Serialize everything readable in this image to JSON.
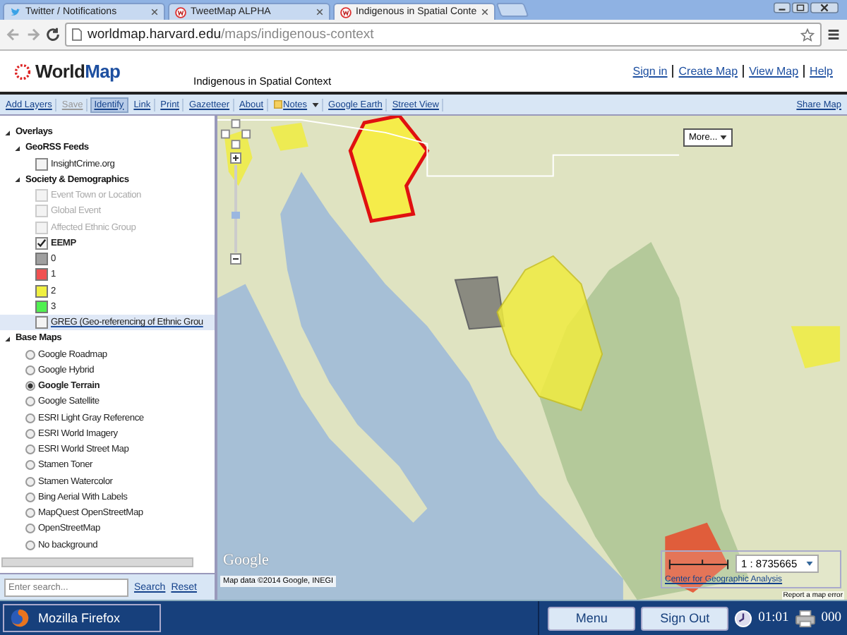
{
  "browser": {
    "tabs": [
      {
        "title": "Twitter / Notifications",
        "selected": false
      },
      {
        "title": "TweetMap ALPHA",
        "selected": false
      },
      {
        "title": "Indigenous in Spatial Conte",
        "selected": true
      }
    ],
    "url": {
      "host": "worldmap.harvard.edu",
      "path": "/maps/indigenous-context"
    }
  },
  "header": {
    "logo_a": "World",
    "logo_b": "Map",
    "title": "Indigenous in Spatial Context",
    "links": [
      "Sign in",
      "Create Map",
      "View Map",
      "Help"
    ]
  },
  "toolbar": {
    "items": [
      {
        "label": "Add Layers",
        "selected": false,
        "disabled": false,
        "kind": "link"
      },
      {
        "label": "Save",
        "selected": false,
        "disabled": true,
        "kind": "link"
      },
      {
        "label": "Identify",
        "selected": true,
        "disabled": false,
        "kind": "link"
      },
      {
        "label": "Link",
        "selected": false,
        "disabled": false,
        "kind": "link"
      },
      {
        "label": "Print",
        "selected": false,
        "disabled": false,
        "kind": "link"
      },
      {
        "label": "Gazetteer",
        "selected": false,
        "disabled": false,
        "kind": "link"
      },
      {
        "label": "About",
        "selected": false,
        "disabled": false,
        "kind": "link"
      },
      {
        "label": "Notes",
        "selected": false,
        "disabled": false,
        "kind": "dropdown"
      },
      {
        "label": "Google Earth",
        "selected": false,
        "disabled": false,
        "kind": "link"
      },
      {
        "label": "Street View",
        "selected": false,
        "disabled": false,
        "kind": "link"
      }
    ],
    "share": "Share Map"
  },
  "sidebar": {
    "tree": [
      {
        "kind": "folder",
        "label": "Overlays",
        "expanded": true,
        "children": [
          {
            "kind": "folder",
            "label": "GeoRSS Feeds",
            "expanded": true,
            "children": [
              {
                "kind": "checkbox",
                "label": "InsightCrime.org",
                "checked": false,
                "disabled": false,
                "selected": false
              }
            ]
          },
          {
            "kind": "folder",
            "label": "Society & Demographics",
            "expanded": true,
            "children": [
              {
                "kind": "checkbox",
                "label": "Event Town or Location",
                "checked": false,
                "disabled": true,
                "selected": false
              },
              {
                "kind": "checkbox",
                "label": "Global Event",
                "checked": false,
                "disabled": true,
                "selected": false
              },
              {
                "kind": "checkbox",
                "label": "Affected Ethnic Group",
                "checked": false,
                "disabled": true,
                "selected": false
              },
              {
                "kind": "checkbox",
                "label": "EEMP",
                "checked": true,
                "disabled": false,
                "selected": false
              },
              {
                "kind": "legend",
                "label": "0",
                "color": "#a0a0a0"
              },
              {
                "kind": "legend",
                "label": "1",
                "color": "#f05050"
              },
              {
                "kind": "legend",
                "label": "2",
                "color": "#f0f040"
              },
              {
                "kind": "legend",
                "label": "3",
                "color": "#50f050"
              },
              {
                "kind": "checkbox",
                "label": "GREG (Geo-referencing of Ethnic Grou",
                "checked": false,
                "disabled": false,
                "selected": true
              }
            ]
          }
        ]
      },
      {
        "kind": "folder",
        "label": "Base Maps",
        "expanded": true,
        "children": [
          {
            "kind": "radio",
            "label": "Google Roadmap",
            "selected": false
          },
          {
            "kind": "radio",
            "label": "Google Hybrid",
            "selected": false
          },
          {
            "kind": "radio",
            "label": "Google Terrain",
            "selected": true
          },
          {
            "kind": "radio",
            "label": "Google Satellite",
            "selected": false
          },
          {
            "kind": "radio",
            "label": "ESRI Light Gray Reference",
            "selected": false
          },
          {
            "kind": "radio",
            "label": "ESRI World Imagery",
            "selected": false
          },
          {
            "kind": "radio",
            "label": "ESRI World Street Map",
            "selected": false
          },
          {
            "kind": "radio",
            "label": "Stamen Toner",
            "selected": false
          },
          {
            "kind": "radio",
            "label": "Stamen Watercolor",
            "selected": false
          },
          {
            "kind": "radio",
            "label": "Bing Aerial With Labels",
            "selected": false
          },
          {
            "kind": "radio",
            "label": "MapQuest OpenStreetMap",
            "selected": false
          },
          {
            "kind": "radio",
            "label": "OpenStreetMap",
            "selected": false
          },
          {
            "kind": "radio",
            "label": "No background",
            "selected": false
          }
        ]
      }
    ],
    "search": {
      "placeholder": "Enter search...",
      "links": [
        "Search",
        "Reset"
      ]
    }
  },
  "map": {
    "more": "More...",
    "scale": "1 : 8735665",
    "credit_logo": "Google",
    "attribution": "Map data ©2014 Google, INEGI",
    "center_link": "Center for Geographic Analysis",
    "report": "Report a map error"
  },
  "taskbar": {
    "app": "Mozilla Firefox",
    "buttons": [
      "Menu",
      "Sign Out"
    ],
    "clock": "01:01",
    "counter": "000"
  }
}
